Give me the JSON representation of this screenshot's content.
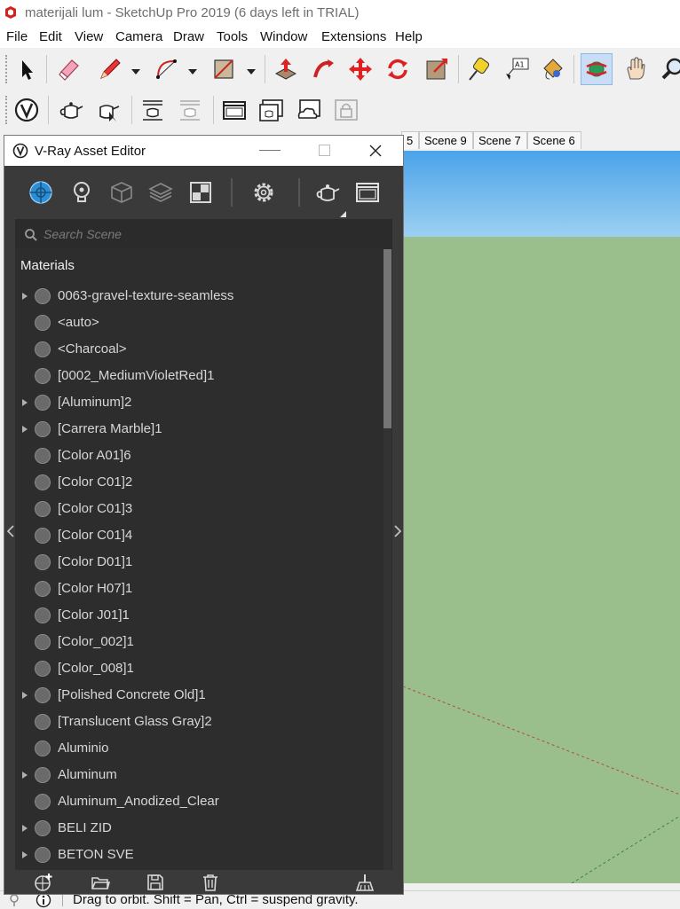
{
  "window": {
    "title": "materijali lum - SketchUp Pro 2019 (6 days left in TRIAL)",
    "logo_icon": "sketchup-logo-icon"
  },
  "menu": [
    "File",
    "Edit",
    "View",
    "Camera",
    "Draw",
    "Tools",
    "Window",
    "Extensions",
    "Help"
  ],
  "toolbar1": [
    "select-icon",
    "eraser-icon",
    "pencil-line-icon",
    "arc-icon",
    "rectangle-icon",
    "push-pull-icon",
    "follow-me-icon",
    "move-icon",
    "rotate-icon",
    "scale-icon",
    "tape-measure-icon",
    "text-label-icon",
    "paint-bucket-icon",
    "orbit-icon",
    "pan-icon",
    "zoom-icon"
  ],
  "toolbar1_selected": "orbit-icon",
  "toolbar1_text_icon_label": "A1",
  "toolbar2": [
    "vray-logo-icon",
    "teapot-icon",
    "interactive-render-icon",
    "batch-render-icon",
    "render-cloud-icon",
    "frame-buffer-icon",
    "render-region-icon",
    "cloud-render-icon",
    "lock-camera-icon"
  ],
  "scenes": [
    "5",
    "Scene 9",
    "Scene 7",
    "Scene 6"
  ],
  "asset_editor": {
    "title": "V-Ray Asset Editor",
    "tabs": [
      "materials-icon",
      "lights-icon",
      "geometry-icon",
      "render-elements-icon",
      "textures-icon",
      "settings-icon",
      "render-teapot-icon",
      "frame-buffer-icon"
    ],
    "search_placeholder": "Search Scene",
    "section": "Materials",
    "materials": [
      {
        "name": "0063-gravel-texture-seamless",
        "expandable": true
      },
      {
        "name": "<auto>",
        "expandable": false
      },
      {
        "name": "<Charcoal>",
        "expandable": false
      },
      {
        "name": "[0002_MediumVioletRed]1",
        "expandable": false
      },
      {
        "name": "[Aluminum]2",
        "expandable": true
      },
      {
        "name": "[Carrera Marble]1",
        "expandable": true
      },
      {
        "name": "[Color A01]6",
        "expandable": false
      },
      {
        "name": "[Color C01]2",
        "expandable": false
      },
      {
        "name": "[Color C01]3",
        "expandable": false
      },
      {
        "name": "[Color C01]4",
        "expandable": false
      },
      {
        "name": "[Color D01]1",
        "expandable": false
      },
      {
        "name": "[Color H07]1",
        "expandable": false
      },
      {
        "name": "[Color J01]1",
        "expandable": false
      },
      {
        "name": "[Color_002]1",
        "expandable": false
      },
      {
        "name": "[Color_008]1",
        "expandable": false
      },
      {
        "name": "[Polished Concrete Old]1",
        "expandable": true
      },
      {
        "name": "[Translucent Glass Gray]2",
        "expandable": false
      },
      {
        "name": "Aluminio",
        "expandable": false
      },
      {
        "name": "Aluminum",
        "expandable": true
      },
      {
        "name": "Aluminum_Anodized_Clear",
        "expandable": false
      },
      {
        "name": "BELI ZID",
        "expandable": true
      },
      {
        "name": "BETON SVE",
        "expandable": true
      }
    ],
    "bottom_icons": [
      "add-material-icon",
      "open-folder-icon",
      "save-icon",
      "delete-icon",
      "purge-icon"
    ]
  },
  "status": {
    "text": "Drag to orbit. Shift = Pan, Ctrl = suspend gravity."
  },
  "colors": {
    "editor_bg": "#3a3a3a",
    "list_bg": "#2d2d2d",
    "sky": "#4aa3e9",
    "ground": "#9bbe8d",
    "selected_tool": "#c9def5"
  }
}
